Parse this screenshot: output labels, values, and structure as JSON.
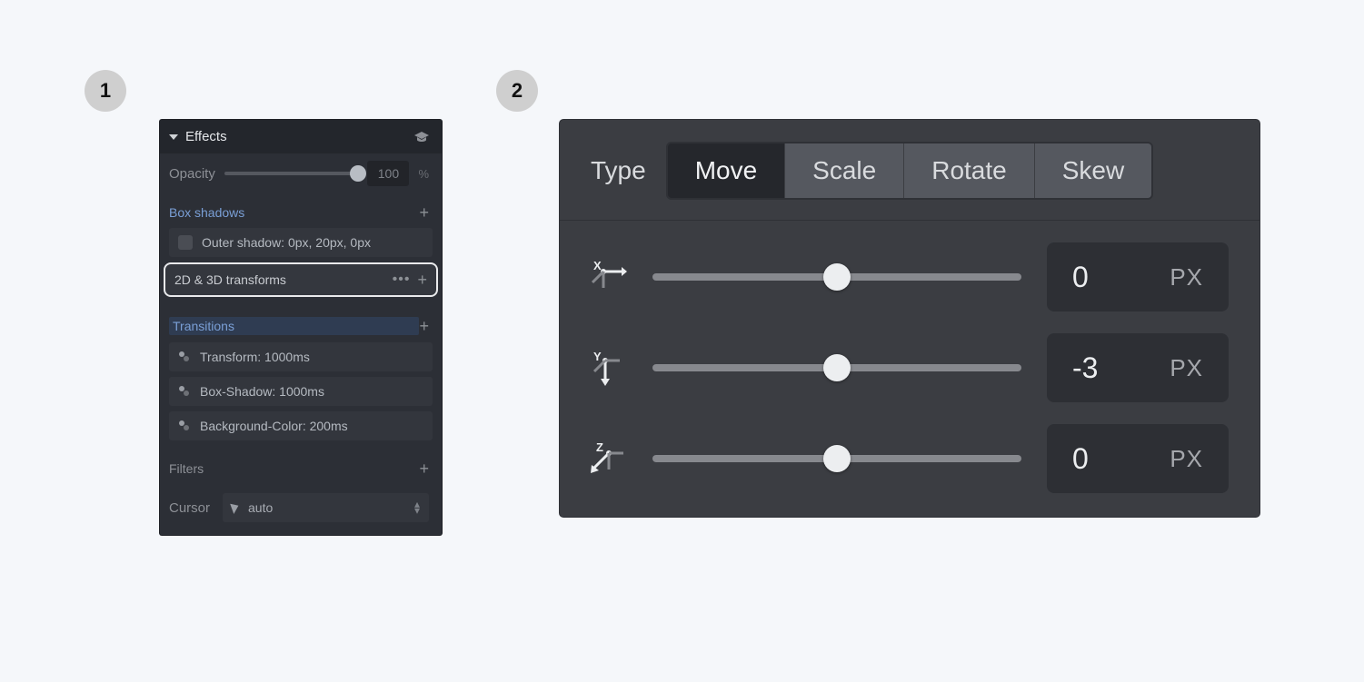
{
  "steps": {
    "one": "1",
    "two": "2"
  },
  "effects": {
    "title": "Effects",
    "opacity": {
      "label": "Opacity",
      "value": "100",
      "unit": "%"
    },
    "boxShadows": {
      "title": "Box shadows",
      "item": "Outer shadow: 0px, 20px, 0px"
    },
    "transforms": {
      "title": "2D & 3D transforms"
    },
    "transitions": {
      "title": "Transitions",
      "items": [
        "Transform: 1000ms",
        "Box-Shadow: 1000ms",
        "Background-Color: 200ms"
      ]
    },
    "filters": {
      "title": "Filters"
    },
    "cursor": {
      "label": "Cursor",
      "value": "auto"
    }
  },
  "transform": {
    "typeLabel": "Type",
    "seg": {
      "move": "Move",
      "scale": "Scale",
      "rotate": "Rotate",
      "skew": "Skew"
    },
    "axes": {
      "x": {
        "value": "0",
        "unit": "PX"
      },
      "y": {
        "value": "-3",
        "unit": "PX"
      },
      "z": {
        "value": "0",
        "unit": "PX"
      }
    }
  }
}
